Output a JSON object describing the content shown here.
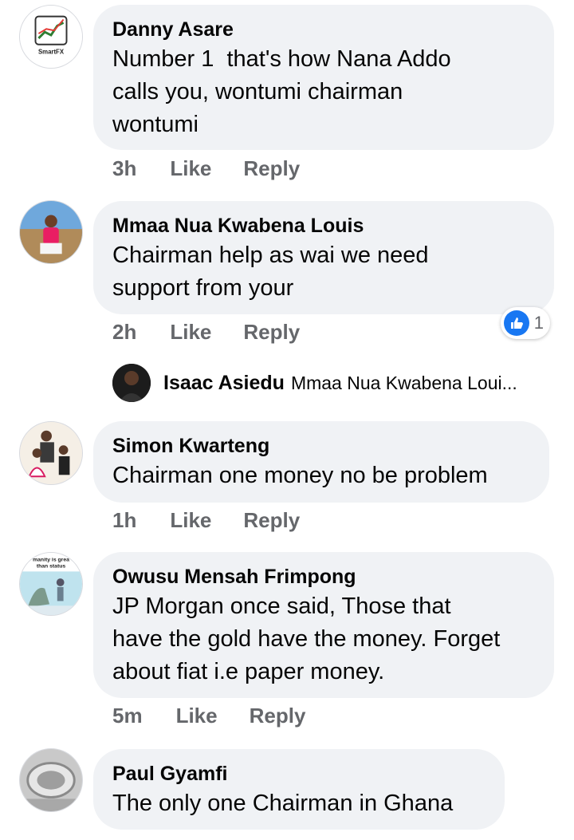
{
  "comments": [
    {
      "author": "Danny Asare",
      "text": "Number 1  that's how Nana Addo\ncalls you, wontumi chairman\nwontumi",
      "time": "3h",
      "like": "Like",
      "reply": "Reply",
      "avatar_label": "SmartFX"
    },
    {
      "author": "Mmaa Nua Kwabena Louis",
      "text": "Chairman help as wai we need\nsupport from your",
      "time": "2h",
      "like": "Like",
      "reply": "Reply",
      "reaction_count": "1"
    },
    {
      "author": "Simon Kwarteng",
      "text": "Chairman one money no be problem",
      "time": "1h",
      "like": "Like",
      "reply": "Reply"
    },
    {
      "author": "Owusu Mensah Frimpong",
      "text": "JP Morgan once said, Those that\nhave the gold have the money. Forget\nabout fiat i.e paper money.",
      "time": "5m",
      "like": "Like",
      "reply": "Reply",
      "avatar_label_1": "manity is grea",
      "avatar_label_2": "than status"
    },
    {
      "author": "Paul Gyamfi",
      "text": "The only one Chairman in Ghana"
    }
  ],
  "reply_preview": {
    "author": "Isaac Asiedu",
    "snippet": "Mmaa Nua Kwabena Loui..."
  },
  "colors": {
    "bubble": "#f0f2f5",
    "meta": "#65676b",
    "like_blue": "#1877f2"
  }
}
